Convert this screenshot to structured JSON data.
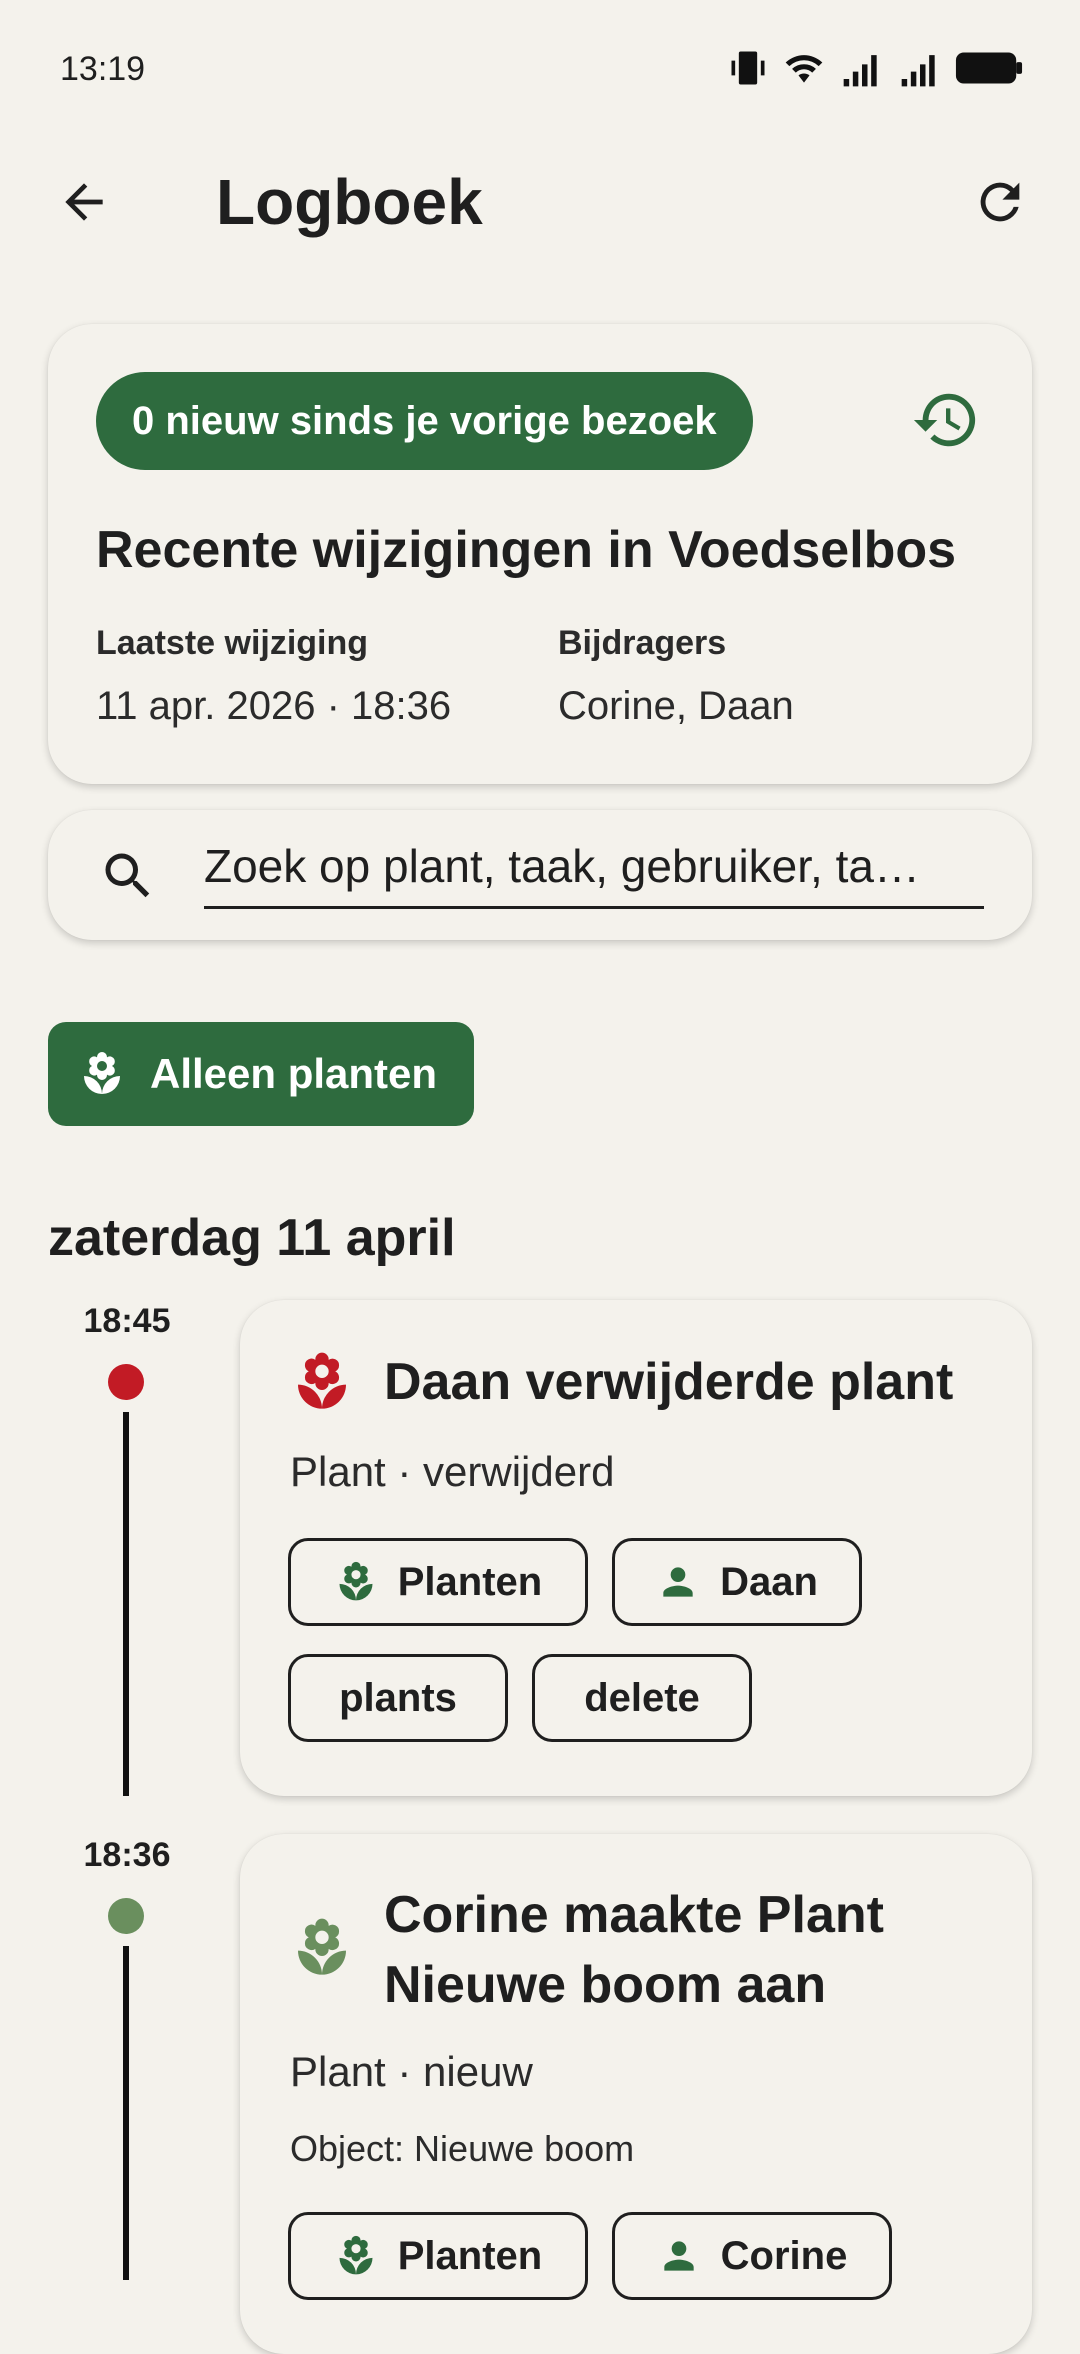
{
  "status_bar": {
    "time": "13:19"
  },
  "app_bar": {
    "title": "Logboek"
  },
  "summary": {
    "badge": "0 nieuw sinds je vorige bezoek",
    "title": "Recente wijzigingen in Voedselbos",
    "last_change_label": "Laatste wijziging",
    "last_change_value": "11 apr. 2026 · 18:36",
    "contributors_label": "Bijdragers",
    "contributors_value": "Corine, Daan"
  },
  "search": {
    "value": "Zoek op plant, taak, gebruiker, ta…",
    "placeholder": "Zoek op plant, taak, gebruiker, tag"
  },
  "filter": {
    "label": "Alleen planten"
  },
  "day": {
    "heading": "zaterdag 11 april",
    "entries": [
      {
        "time": "18:45",
        "dot_color": "#c21b25",
        "icon": "flower-icon",
        "icon_color": "#c21b25",
        "title": "Daan verwijderde plant",
        "subtitle": "Plant · verwijderd",
        "chips": [
          {
            "label": "Planten",
            "icon": "flower-icon"
          },
          {
            "label": "Daan",
            "icon": "person-icon"
          },
          {
            "label": "plants"
          },
          {
            "label": "delete"
          }
        ]
      },
      {
        "time": "18:36",
        "dot_color": "#6a8f5e",
        "icon": "flower-icon",
        "icon_color": "#6a8f5e",
        "title_line1": "Corine maakte Plant",
        "title_line2": "Nieuwe boom aan",
        "subtitle": "Plant · nieuw",
        "object": "Object: Nieuwe boom",
        "chips": [
          {
            "label": "Planten",
            "icon": "flower-icon"
          },
          {
            "label": "Corine",
            "icon": "person-icon"
          }
        ]
      }
    ]
  },
  "colors": {
    "accent": "#2e6b3e",
    "background": "#f4f2ec",
    "delete": "#c21b25",
    "new": "#6a8f5e"
  }
}
